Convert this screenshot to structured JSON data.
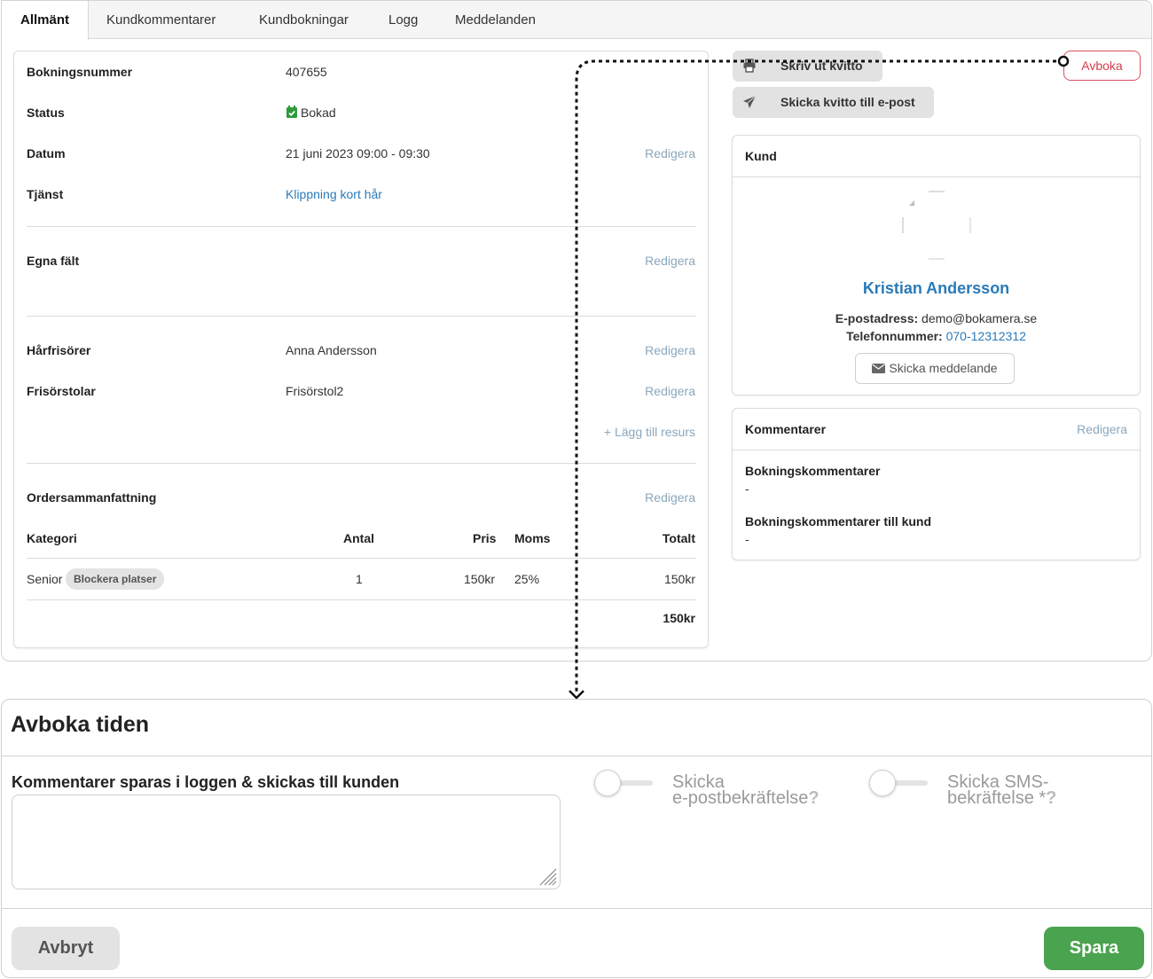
{
  "tabs": [
    "Allmänt",
    "Kundkommentarer",
    "Kundbokningar",
    "Logg",
    "Meddelanden"
  ],
  "booking": {
    "number_label": "Bokningsnummer",
    "number": "407655",
    "status_label": "Status",
    "status": "Bokad",
    "date_label": "Datum",
    "date": "21 juni 2023 09:00 - 09:30",
    "service_label": "Tjänst",
    "service": "Klippning kort hår",
    "custom_fields_label": "Egna fält",
    "stylists_label": "Hårfrisörer",
    "stylist": "Anna Andersson",
    "chairs_label": "Frisörstolar",
    "chair": "Frisörstol2",
    "add_resource": "+ Lägg till resurs",
    "edit": "Redigera"
  },
  "order": {
    "title": "Ordersammanfattning",
    "edit": "Redigera",
    "headers": {
      "category": "Kategori",
      "qty": "Antal",
      "price": "Pris",
      "vat": "Moms",
      "total": "Totalt"
    },
    "row": {
      "category": "Senior",
      "badge": "Blockera platser",
      "qty": "1",
      "price": "150kr",
      "vat": "25%",
      "total": "150kr"
    },
    "grand_total": "150kr"
  },
  "actions": {
    "print": "Skriv ut kvitto",
    "email": "Skicka kvitto till e-post",
    "cancel": "Avboka"
  },
  "customer": {
    "title": "Kund",
    "name": "Kristian Andersson",
    "email_label": "E-postadress:",
    "email": "demo@bokamera.se",
    "phone_label": "Telefonnummer:",
    "phone": "070-12312312",
    "message_button": "Skicka meddelande"
  },
  "comments": {
    "title": "Kommentarer",
    "edit": "Redigera",
    "booking_comments_label": "Bokningskommentarer",
    "booking_comments": "-",
    "customer_comments_label": "Bokningskommentarer till kund",
    "customer_comments": "-"
  },
  "cancel_dialog": {
    "title": "Avboka tiden",
    "comment_label": "Kommentarer sparas i loggen & skickas till kunden",
    "email_toggle_line1": "Skicka",
    "email_toggle_line2": "e-postbekräftelse",
    "sms_toggle_line1": "Skicka SMS-",
    "sms_toggle_line2": "bekräftelse *",
    "help": "?",
    "cancel_button": "Avbryt",
    "save_button": "Spara"
  },
  "colors": {
    "link": "#2a7ab8",
    "cancel_red": "#d23d4c",
    "save_green": "#4aa34f",
    "status_green": "#2e9a3a"
  }
}
